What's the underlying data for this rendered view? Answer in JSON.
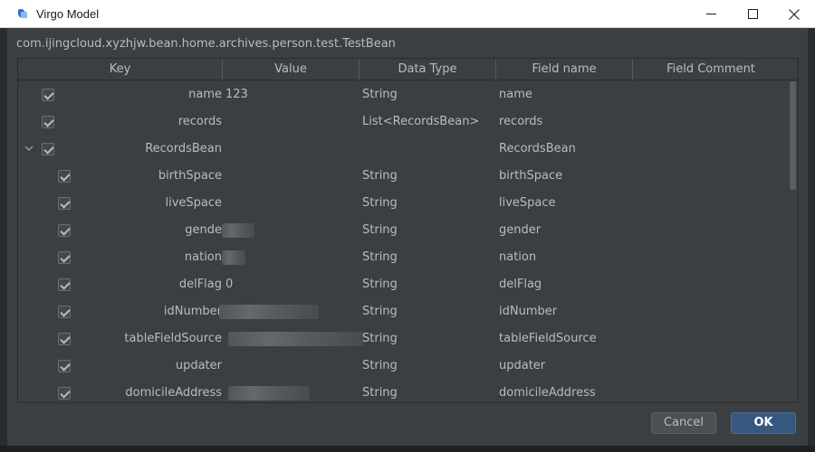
{
  "window": {
    "title": "Virgo Model"
  },
  "dialog": {
    "class_path": "com.ijingcloud.xyzhjw.bean.home.archives.person.test.TestBean",
    "columns": [
      "Key",
      "Value",
      "Data Type",
      "Field name",
      "Field Comment"
    ],
    "rows": [
      {
        "key": "name",
        "value": "123",
        "type": "String",
        "field": "name",
        "comment": "",
        "checked": true,
        "level": 0,
        "expander": false
      },
      {
        "key": "records",
        "value": "",
        "type": "List<RecordsBean>",
        "field": "records",
        "comment": "",
        "checked": true,
        "level": 0,
        "expander": false
      },
      {
        "key": "RecordsBean",
        "value": "",
        "type": "",
        "field": "RecordsBean",
        "comment": "",
        "checked": true,
        "level": 0,
        "expander": true
      },
      {
        "key": "birthSpace",
        "value": "",
        "type": "String",
        "field": "birthSpace",
        "comment": "",
        "checked": true,
        "level": 1,
        "expander": false
      },
      {
        "key": "liveSpace",
        "value": "",
        "type": "String",
        "field": "liveSpace",
        "comment": "",
        "checked": true,
        "level": 1,
        "expander": false
      },
      {
        "key": "gende",
        "value": "",
        "type": "String",
        "field": "gender",
        "comment": "",
        "checked": true,
        "level": 1,
        "expander": false,
        "redacted": true
      },
      {
        "key": "nation",
        "value": "",
        "type": "String",
        "field": "nation",
        "comment": "",
        "checked": true,
        "level": 1,
        "expander": false,
        "redacted": true
      },
      {
        "key": "delFlag",
        "value": "0",
        "type": "String",
        "field": "delFlag",
        "comment": "",
        "checked": true,
        "level": 1,
        "expander": false
      },
      {
        "key": "idNumber",
        "value": "",
        "type": "String",
        "field": "idNumber",
        "comment": "",
        "checked": true,
        "level": 1,
        "expander": false,
        "redacted": true
      },
      {
        "key": "tableFieldSource",
        "value": "",
        "type": "String",
        "field": "tableFieldSource",
        "comment": "",
        "checked": true,
        "level": 1,
        "expander": false,
        "redacted": true
      },
      {
        "key": "updater",
        "value": "",
        "type": "String",
        "field": "updater",
        "comment": "",
        "checked": true,
        "level": 1,
        "expander": false
      },
      {
        "key": "domicileAddress",
        "value": "",
        "type": "String",
        "field": "domicileAddress",
        "comment": "",
        "checked": true,
        "level": 1,
        "expander": false,
        "redacted": true
      }
    ]
  },
  "buttons": {
    "cancel": "Cancel",
    "ok": "OK"
  },
  "icons": {
    "app": "virgo-app-icon",
    "minimize": "minimize-icon",
    "maximize": "maximize-icon",
    "close": "close-icon",
    "checkbox": "checkbox-checked-icon",
    "expander": "chevron-down-icon"
  },
  "colors": {
    "background": "#3c3f41",
    "primary_button": "#365880",
    "text": "#bbbbbb"
  }
}
